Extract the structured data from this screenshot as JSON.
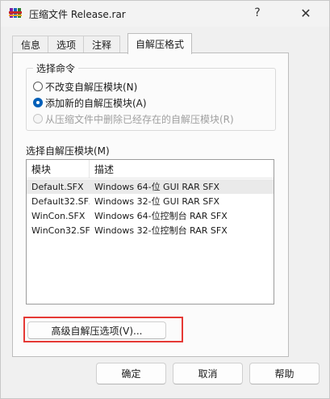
{
  "window": {
    "title": "压缩文件 Release.rar",
    "help_glyph": "?",
    "close_glyph": "✕"
  },
  "tabs": [
    {
      "label": "信息"
    },
    {
      "label": "选项"
    },
    {
      "label": "注释"
    },
    {
      "label": "自解压格式",
      "active": true
    }
  ],
  "command_group": {
    "title": "选择命令",
    "options": [
      {
        "label": "不改变自解压模块(N)",
        "checked": false,
        "disabled": false
      },
      {
        "label": "添加新的自解压模块(A)",
        "checked": true,
        "disabled": false
      },
      {
        "label": "从压缩文件中删除已经存在的自解压模块(R)",
        "checked": false,
        "disabled": true
      }
    ]
  },
  "module_list": {
    "label": "选择自解压模块(M)",
    "columns": [
      "模块",
      "描述"
    ],
    "rows": [
      {
        "module": "Default.SFX",
        "description": "Windows 64-位 GUI RAR SFX",
        "selected": true
      },
      {
        "module": "Default32.SFX",
        "description": "Windows 32-位 GUI RAR SFX",
        "selected": false
      },
      {
        "module": "WinCon.SFX",
        "description": "Windows 64-位控制台 RAR SFX",
        "selected": false
      },
      {
        "module": "WinCon32.SFX",
        "description": "Windows 32-位控制台 RAR SFX",
        "selected": false
      }
    ]
  },
  "advanced_button": {
    "label": "高级自解压选项(V)..."
  },
  "footer": {
    "ok_label": "确定",
    "cancel_label": "取消",
    "help_label": "帮助"
  },
  "colors": {
    "accent": "#005fb8",
    "highlight_box": "#e53935"
  }
}
